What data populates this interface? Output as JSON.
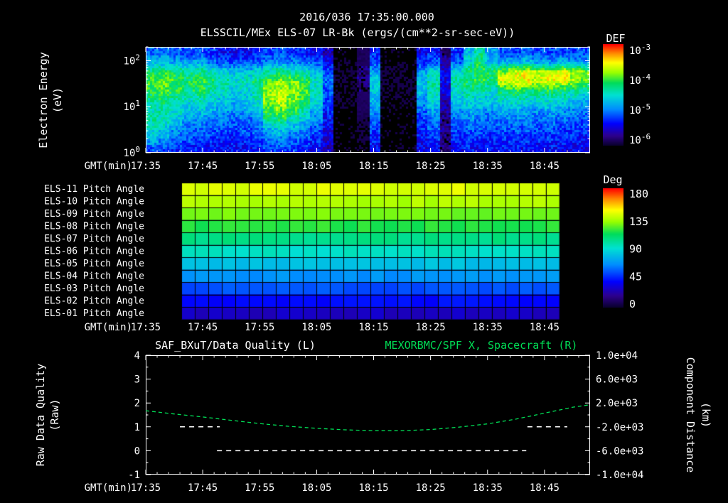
{
  "header": {
    "timestamp": "2016/036 17:35:00.000",
    "title": "ELSSCIL/MEx ELS-07 LR-Bk  (ergs/(cm**2-sr-sec-eV))"
  },
  "colors": {
    "background": "#000000",
    "fg": "#ffffff",
    "accent_green": "#00dd55",
    "frame": "#ffffff"
  },
  "time_axis": {
    "label": "GMT(min)",
    "start": "17:35",
    "total_min": 78,
    "tick_minutes": [
      0,
      10,
      20,
      30,
      40,
      50,
      60,
      70
    ],
    "tick_labels": [
      "17:35",
      "17:45",
      "17:55",
      "18:05",
      "18:15",
      "18:25",
      "18:35",
      "18:45"
    ],
    "minor_step_min": 2
  },
  "chart_data": [
    {
      "id": "electron_spectrogram",
      "type": "heatmap",
      "ylabel": "Electron Energy",
      "ylabel_units": "(eV)",
      "y_scale": "log",
      "ylim_ev": [
        1,
        200
      ],
      "y_tick_labels": [
        "10^2",
        "10^1",
        "10^0"
      ],
      "y_tick_exponents": [
        2,
        1,
        0
      ],
      "colorbar": {
        "label": "DEF",
        "tick_labels": [
          "10^-3",
          "10^-4",
          "10^-5",
          "10^-6"
        ],
        "log10_range": [
          -6,
          -3
        ]
      },
      "value_scale": "normalized log10 DEF: 0 = 1e-6, 1 = 1e-3",
      "n_time_cols": 38,
      "n_energy_rows": 11,
      "grid": [
        [
          0.32,
          0.35,
          0.3,
          0.28,
          0.3,
          0.26,
          0.22,
          0.2,
          0.22,
          0.24,
          0.28,
          0.3,
          0.26,
          0.25,
          0.22,
          0.15,
          0.02,
          0.02,
          0.05,
          0.25,
          0.02,
          0.02,
          0.02,
          0.2,
          0.25,
          0.1,
          0.25,
          0.45,
          0.55,
          0.4,
          0.3,
          0.28,
          0.32,
          0.3,
          0.28,
          0.3,
          0.27,
          0.3
        ],
        [
          0.45,
          0.42,
          0.4,
          0.38,
          0.4,
          0.35,
          0.3,
          0.28,
          0.3,
          0.32,
          0.35,
          0.38,
          0.35,
          0.33,
          0.3,
          0.2,
          0.02,
          0.02,
          0.05,
          0.3,
          0.02,
          0.02,
          0.02,
          0.25,
          0.3,
          0.12,
          0.3,
          0.5,
          0.6,
          0.45,
          0.4,
          0.42,
          0.45,
          0.4,
          0.38,
          0.42,
          0.4,
          0.38
        ],
        [
          0.6,
          0.62,
          0.58,
          0.55,
          0.58,
          0.52,
          0.48,
          0.45,
          0.45,
          0.5,
          0.55,
          0.58,
          0.55,
          0.5,
          0.45,
          0.3,
          0.03,
          0.03,
          0.08,
          0.4,
          0.03,
          0.03,
          0.03,
          0.4,
          0.5,
          0.18,
          0.5,
          0.58,
          0.62,
          0.6,
          0.72,
          0.78,
          0.8,
          0.76,
          0.78,
          0.8,
          0.75,
          0.72
        ],
        [
          0.68,
          0.7,
          0.66,
          0.62,
          0.65,
          0.6,
          0.55,
          0.5,
          0.52,
          0.58,
          0.68,
          0.72,
          0.7,
          0.62,
          0.5,
          0.32,
          0.03,
          0.03,
          0.08,
          0.48,
          0.03,
          0.03,
          0.03,
          0.45,
          0.55,
          0.2,
          0.55,
          0.6,
          0.62,
          0.58,
          0.78,
          0.8,
          0.82,
          0.78,
          0.8,
          0.78,
          0.74,
          0.7
        ],
        [
          0.62,
          0.65,
          0.62,
          0.58,
          0.6,
          0.55,
          0.5,
          0.46,
          0.48,
          0.55,
          0.72,
          0.75,
          0.72,
          0.65,
          0.52,
          0.3,
          0.03,
          0.03,
          0.06,
          0.45,
          0.03,
          0.03,
          0.03,
          0.42,
          0.52,
          0.18,
          0.5,
          0.55,
          0.55,
          0.5,
          0.6,
          0.62,
          0.6,
          0.58,
          0.6,
          0.58,
          0.55,
          0.52
        ],
        [
          0.55,
          0.58,
          0.55,
          0.5,
          0.52,
          0.48,
          0.45,
          0.42,
          0.44,
          0.5,
          0.72,
          0.75,
          0.7,
          0.62,
          0.48,
          0.28,
          0.03,
          0.03,
          0.05,
          0.42,
          0.03,
          0.03,
          0.03,
          0.38,
          0.48,
          0.15,
          0.45,
          0.5,
          0.48,
          0.45,
          0.5,
          0.52,
          0.5,
          0.48,
          0.5,
          0.48,
          0.45,
          0.42
        ],
        [
          0.52,
          0.55,
          0.5,
          0.45,
          0.45,
          0.42,
          0.4,
          0.38,
          0.4,
          0.45,
          0.65,
          0.7,
          0.62,
          0.55,
          0.42,
          0.25,
          0.02,
          0.02,
          0.05,
          0.38,
          0.02,
          0.02,
          0.02,
          0.32,
          0.4,
          0.12,
          0.38,
          0.42,
          0.4,
          0.38,
          0.4,
          0.42,
          0.4,
          0.38,
          0.4,
          0.38,
          0.36,
          0.34
        ],
        [
          0.55,
          0.52,
          0.45,
          0.4,
          0.38,
          0.36,
          0.34,
          0.32,
          0.34,
          0.4,
          0.55,
          0.6,
          0.5,
          0.45,
          0.36,
          0.22,
          0.02,
          0.02,
          0.04,
          0.32,
          0.02,
          0.02,
          0.02,
          0.28,
          0.34,
          0.1,
          0.32,
          0.36,
          0.34,
          0.32,
          0.35,
          0.36,
          0.35,
          0.33,
          0.35,
          0.33,
          0.32,
          0.3
        ],
        [
          0.5,
          0.45,
          0.38,
          0.34,
          0.32,
          0.3,
          0.3,
          0.28,
          0.3,
          0.34,
          0.42,
          0.45,
          0.4,
          0.36,
          0.3,
          0.2,
          0.02,
          0.02,
          0.03,
          0.28,
          0.02,
          0.02,
          0.02,
          0.25,
          0.3,
          0.1,
          0.28,
          0.3,
          0.3,
          0.28,
          0.3,
          0.3,
          0.3,
          0.28,
          0.3,
          0.28,
          0.27,
          0.26
        ],
        [
          0.42,
          0.38,
          0.32,
          0.3,
          0.28,
          0.27,
          0.26,
          0.25,
          0.26,
          0.3,
          0.34,
          0.36,
          0.32,
          0.3,
          0.26,
          0.18,
          0.02,
          0.02,
          0.03,
          0.25,
          0.02,
          0.02,
          0.02,
          0.22,
          0.26,
          0.08,
          0.25,
          0.27,
          0.26,
          0.25,
          0.26,
          0.27,
          0.26,
          0.25,
          0.26,
          0.25,
          0.24,
          0.23
        ],
        [
          0.3,
          0.28,
          0.26,
          0.25,
          0.24,
          0.23,
          0.22,
          0.22,
          0.22,
          0.25,
          0.28,
          0.3,
          0.27,
          0.25,
          0.22,
          0.15,
          0.02,
          0.02,
          0.02,
          0.2,
          0.02,
          0.02,
          0.02,
          0.2,
          0.22,
          0.07,
          0.21,
          0.23,
          0.22,
          0.21,
          0.22,
          0.23,
          0.22,
          0.21,
          0.22,
          0.21,
          0.2,
          0.2
        ]
      ]
    },
    {
      "id": "pitch_angle_panel",
      "type": "heatmap",
      "colorbar": {
        "label": "Deg",
        "tick_labels": [
          "180",
          "135",
          "90",
          "45",
          "0"
        ],
        "range": [
          0,
          180
        ]
      },
      "data_start_min": 6.3,
      "data_end_min": 72.6,
      "n_cols": 28,
      "rows": [
        {
          "label": "ELS-11 Pitch Angle",
          "deg": 142
        },
        {
          "label": "ELS-10 Pitch Angle",
          "deg": 134
        },
        {
          "label": "ELS-09 Pitch Angle",
          "deg": 126
        },
        {
          "label": "ELS-08 Pitch Angle",
          "deg": 116
        },
        {
          "label": "ELS-07 Pitch Angle",
          "deg": 104
        },
        {
          "label": "ELS-06 Pitch Angle",
          "deg": 92
        },
        {
          "label": "ELS-05 Pitch Angle",
          "deg": 80
        },
        {
          "label": "ELS-04 Pitch Angle",
          "deg": 67
        },
        {
          "label": "ELS-03 Pitch Angle",
          "deg": 54
        },
        {
          "label": "ELS-02 Pitch Angle",
          "deg": 41
        },
        {
          "label": "ELS-01 Pitch Angle",
          "deg": 28
        }
      ]
    },
    {
      "id": "quality_and_distance",
      "type": "line",
      "title_left": "SAF_BXuT/Data Quality (L)",
      "title_right": "MEXORBMC/SPF X, Spacecraft (R)",
      "left_axis": {
        "label": "Raw Data Quality",
        "units": "(Raw)",
        "ylim": [
          -1,
          4
        ],
        "tick_labels": [
          "4",
          "3",
          "2",
          "1",
          "0",
          "-1"
        ]
      },
      "right_axis": {
        "label": "Component Distance",
        "units": "(km)",
        "ylim": [
          -10000,
          10000
        ],
        "tick_labels": [
          "1.0e+04",
          "6.0e+03",
          "2.0e+03",
          "-2.0e+03",
          "-6.0e+03",
          "-1.0e+04"
        ]
      },
      "series": [
        {
          "name": "Raw Data Quality",
          "axis": "left",
          "style": "white-dashed",
          "segments": [
            {
              "value": 1,
              "t_min": [
                6,
                13
              ]
            },
            {
              "value": 0,
              "t_min": [
                12.5,
                66.8
              ]
            },
            {
              "value": 1,
              "t_min": [
                67,
                74
              ]
            }
          ]
        },
        {
          "name": "Spacecraft X Component Distance",
          "axis": "right",
          "style": "green-dashed",
          "t_min": [
            0,
            5,
            10,
            15,
            20,
            25,
            30,
            35,
            40,
            45,
            50,
            55,
            60,
            65,
            70,
            75,
            78
          ],
          "km": [
            700,
            150,
            -350,
            -900,
            -1450,
            -1900,
            -2250,
            -2500,
            -2650,
            -2650,
            -2450,
            -2050,
            -1500,
            -700,
            300,
            1300,
            1700
          ]
        }
      ]
    }
  ]
}
